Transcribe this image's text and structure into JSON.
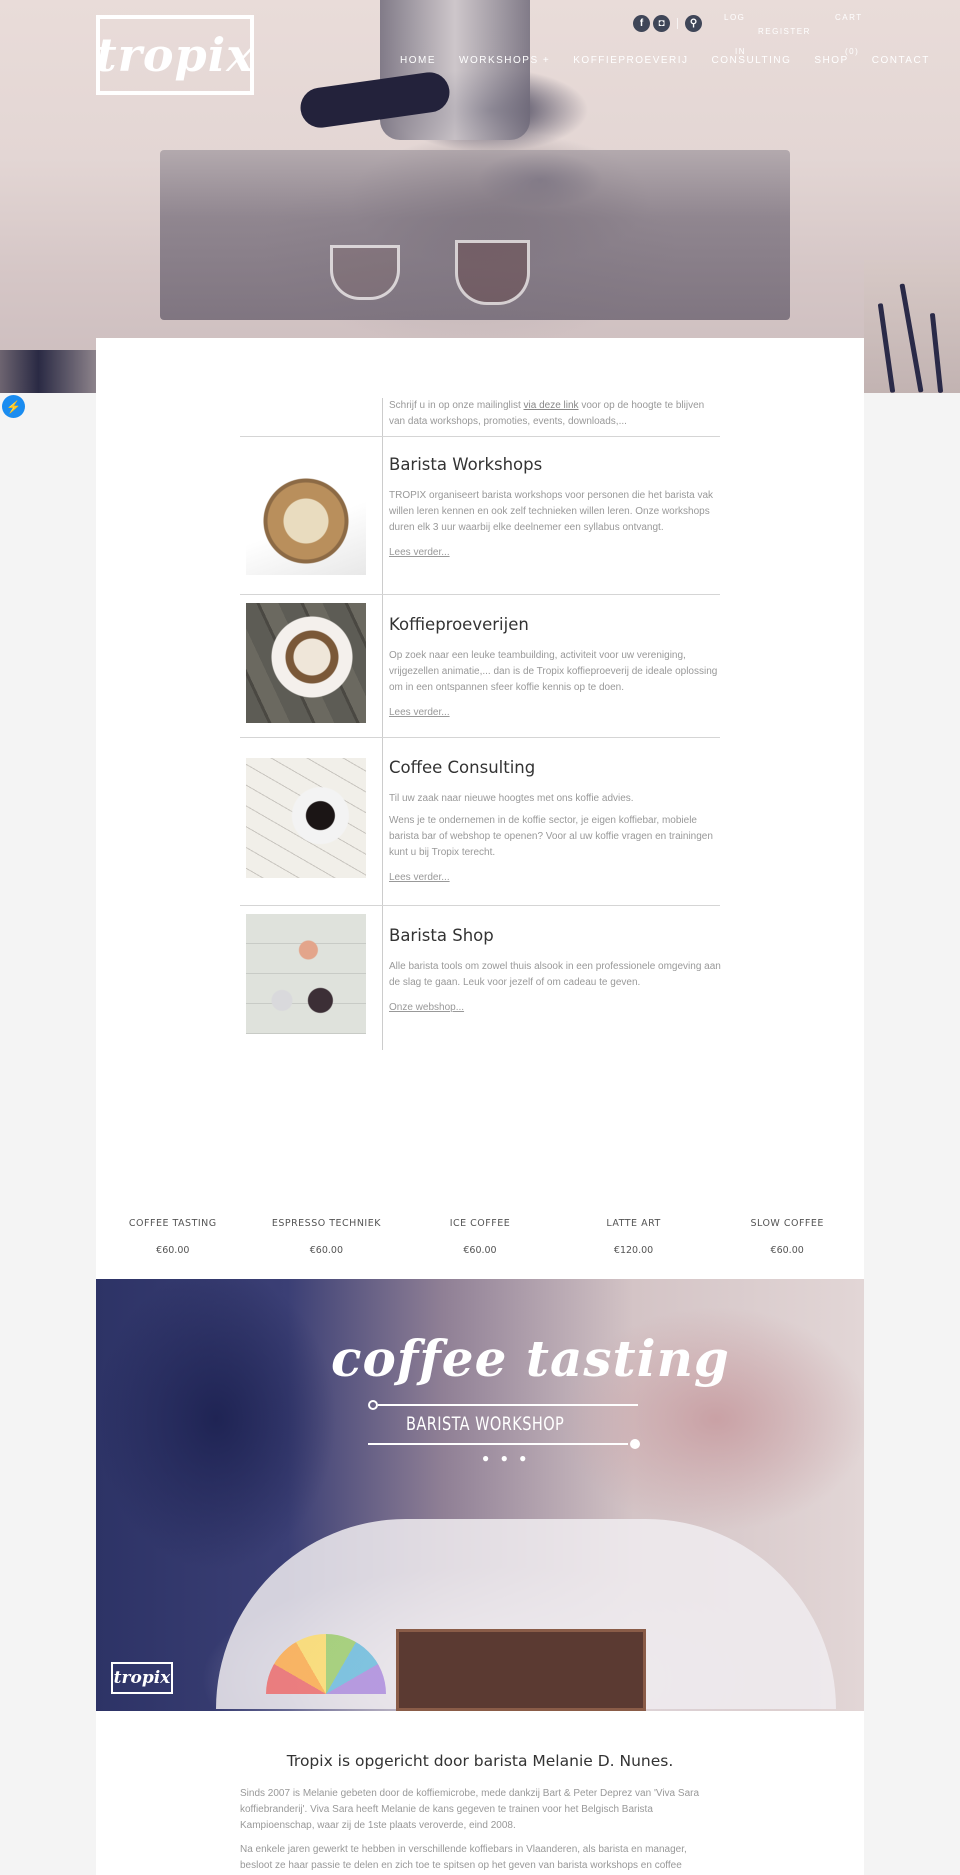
{
  "header": {
    "logo_text": "tropix",
    "social_icons": [
      {
        "name": "facebook-icon",
        "glyph": "f"
      },
      {
        "name": "instagram-icon",
        "glyph": "◘"
      }
    ],
    "search_icon_glyph": "⚲",
    "top_links": {
      "log_in_line1": "LOG",
      "log_in_line2": "IN",
      "register": "REGISTER",
      "cart_line1": "CART",
      "cart_line2": "(0)"
    },
    "nav": [
      {
        "label": "HOME"
      },
      {
        "label": "WORKSHOPS +"
      },
      {
        "label": "KOFFIEPROEVERIJ"
      },
      {
        "label": "CONSULTING"
      },
      {
        "label": "SHOP"
      },
      {
        "label": "CONTACT"
      }
    ]
  },
  "messenger_icon_glyph": "⚡",
  "intro": {
    "before_link": "Schrijf u in op onze mailinglist ",
    "link": "via deze link",
    "after_link": " voor op de hoogte te blijven van data workshops, promoties, events, downloads,..."
  },
  "services": [
    {
      "title": "Barista Workshops",
      "paragraphs": [
        "TROPIX organiseert barista workshops voor personen die het barista vak willen leren kennen  en ook zelf technieken willen leren. Onze workshops duren elk 3 uur waarbij elke deelnemer een syllabus ontvangt."
      ],
      "link": "Lees verder..."
    },
    {
      "title": "Koffieproeverijen",
      "paragraphs": [
        "Op zoek naar een leuke teambuilding, activiteit voor uw vereniging, vrijgezellen animatie,... dan is de Tropix koffieproeverij de ideale oplossing om in een ontspannen sfeer koffie kennis op te doen."
      ],
      "link": "Lees verder..."
    },
    {
      "title": "Coffee Consulting",
      "paragraphs": [
        "Til uw zaak naar nieuwe hoogtes met ons koffie advies.",
        "Wens je te ondernemen in de koffie sector, je eigen koffiebar, mobiele barista bar of webshop te openen? Voor al uw koffie vragen en trainingen kunt u bij Tropix terecht."
      ],
      "link": "Lees verder..."
    },
    {
      "title": "Barista Shop",
      "paragraphs": [
        "Alle barista tools om zowel thuis alsook in een professionele omgeving aan de slag te gaan. Leuk voor jezelf of om cadeau te geven."
      ],
      "link": "Onze webshop..."
    }
  ],
  "products": [
    {
      "name": "COFFEE TASTING",
      "price": "€60.00"
    },
    {
      "name": "ESPRESSO TECHNIEK",
      "price": "€60.00"
    },
    {
      "name": "ICE COFFEE",
      "price": "€60.00"
    },
    {
      "name": "LATTE ART",
      "price": "€120.00"
    },
    {
      "name": "SLOW COFFEE",
      "price": "€60.00"
    }
  ],
  "banner": {
    "title": "coffee tasting",
    "subtitle": "BARISTA WORKSHOP",
    "beans": "● ● ●",
    "logo_text": "tropix"
  },
  "about": {
    "heading": "Tropix is opgericht door barista Melanie D. Nunes.",
    "paragraphs": [
      "Sinds 2007 is Melanie gebeten door de koffiemicrobe, mede dankzij Bart & Peter Deprez van 'Viva Sara koffiebranderij'. Viva Sara heeft Melanie de kans gegeven te trainen voor het Belgisch Barista Kampioenschap, waar zij de 1ste plaats veroverde, eind 2008.",
      "Na enkele jaren gewerkt te hebben in verschillende koffiebars in Vlaanderen, als barista en manager, besloot ze haar passie te delen en zich toe te spitsen op het geven van barista workshops en coffee"
    ]
  }
}
